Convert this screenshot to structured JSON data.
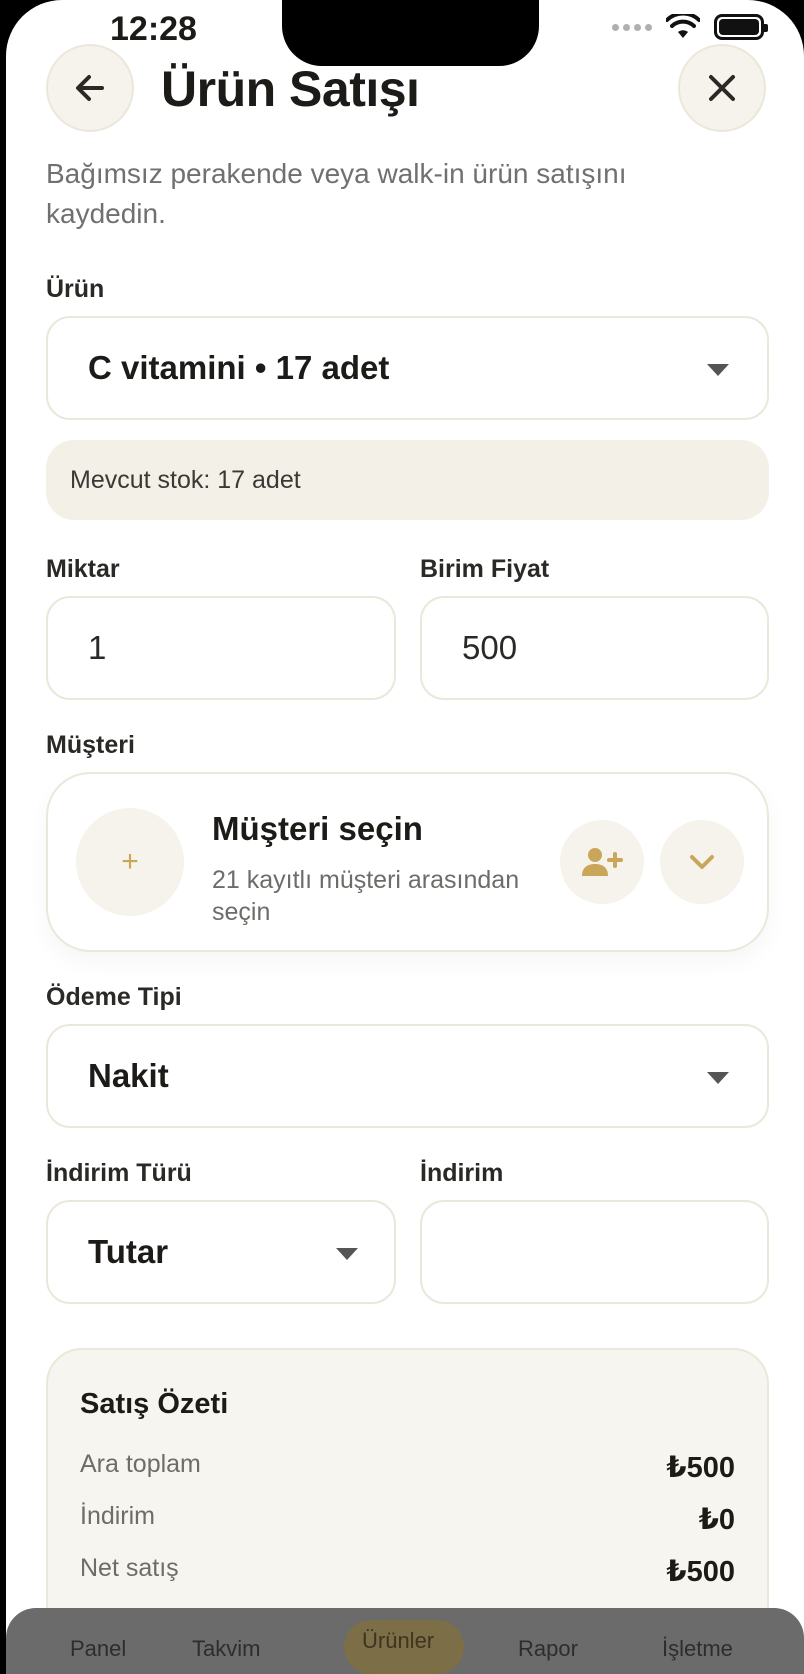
{
  "status_bar": {
    "time": "12:28"
  },
  "header": {
    "title": "Ürün Satışı",
    "description": "Bağımsız perakende veya walk-in ürün satışını kaydedin."
  },
  "product": {
    "label": "Ürün",
    "selected": "C vitamini • 17 adet",
    "stock_info": "Mevcut stok: 17 adet"
  },
  "quantity": {
    "label": "Miktar",
    "value": "1"
  },
  "unit_price": {
    "label": "Birim Fiyat",
    "value": "500"
  },
  "customer": {
    "label": "Müşteri",
    "title": "Müşteri seçin",
    "subtitle": "21 kayıtlı müşteri arasından seçin",
    "plus": "+"
  },
  "payment": {
    "label": "Ödeme Tipi",
    "selected": "Nakit"
  },
  "discount_type": {
    "label": "İndirim Türü",
    "selected": "Tutar"
  },
  "discount": {
    "label": "İndirim",
    "value": ""
  },
  "summary": {
    "title": "Satış Özeti",
    "rows": [
      {
        "label": "Ara toplam",
        "amount": "₺500"
      },
      {
        "label": "İndirim",
        "amount": "₺0"
      },
      {
        "label": "Net satış",
        "amount": "₺500"
      }
    ]
  },
  "tabs": [
    "Panel",
    "Takvim",
    "Ürünler",
    "Rapor",
    "İşletme"
  ],
  "colors": {
    "accent": "#c9a65a",
    "surface": "#f5f3ec",
    "border": "#ebe7da"
  }
}
